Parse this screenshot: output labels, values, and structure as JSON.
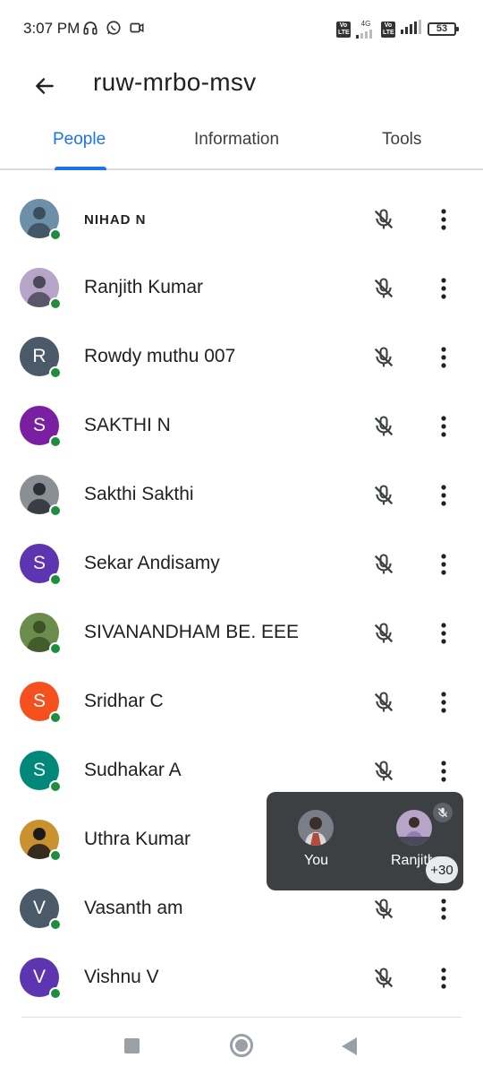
{
  "status_bar": {
    "time": "3:07 PM",
    "left_icons": [
      "headphones-icon",
      "whatsapp-icon",
      "video-camera-icon"
    ],
    "sim1_label": "Vo LTE",
    "network_label": "4G",
    "sim2_label": "Vo LTE",
    "battery": "53"
  },
  "header": {
    "back_icon": "arrow-back-icon",
    "title": "ruw-mrbo-msv"
  },
  "tabs": [
    {
      "label": "People",
      "active": true
    },
    {
      "label": "Information",
      "active": false
    },
    {
      "label": "Tools",
      "active": false
    }
  ],
  "participants": [
    {
      "name": "NIHAD N",
      "avatar_type": "photo",
      "photo_colors": [
        "#6d8fa8",
        "#3b4e5c"
      ]
    },
    {
      "name": "Ranjith Kumar",
      "avatar_type": "photo",
      "photo_colors": [
        "#b7a4c9",
        "#4a4a5a"
      ]
    },
    {
      "name": "Rowdy muthu 007",
      "avatar_type": "letter",
      "letter": "R",
      "color": "#4b5a68"
    },
    {
      "name": "SAKTHI N",
      "avatar_type": "letter",
      "letter": "S",
      "color": "#7b1fa2"
    },
    {
      "name": "Sakthi Sakthi",
      "avatar_type": "photo",
      "photo_colors": [
        "#8a8f96",
        "#2b2f36"
      ]
    },
    {
      "name": "Sekar Andisamy",
      "avatar_type": "letter",
      "letter": "S",
      "color": "#5e35b1"
    },
    {
      "name": "SIVANANDHAM BE. EEE",
      "avatar_type": "photo",
      "photo_colors": [
        "#6b8c4a",
        "#3d5227"
      ]
    },
    {
      "name": "Sridhar C",
      "avatar_type": "letter",
      "letter": "S",
      "color": "#f4511e"
    },
    {
      "name": "Sudhakar A",
      "avatar_type": "letter",
      "letter": "S",
      "color": "#00897b"
    },
    {
      "name": "Uthra Kumar",
      "avatar_type": "photo",
      "photo_colors": [
        "#c9922e",
        "#1a1a1a"
      ]
    },
    {
      "name": "Vasanth am",
      "avatar_type": "letter",
      "letter": "V",
      "color": "#4b5a68"
    },
    {
      "name": "Vishnu V",
      "avatar_type": "letter",
      "letter": "V",
      "color": "#5e35b1"
    }
  ],
  "floating_tile": {
    "self_label": "You",
    "other_label": "Ranjith",
    "extra_count": "+30"
  },
  "colors": {
    "accent": "#1a73e8",
    "presence": "#1e8e3e",
    "tile_bg": "#3c4043"
  }
}
